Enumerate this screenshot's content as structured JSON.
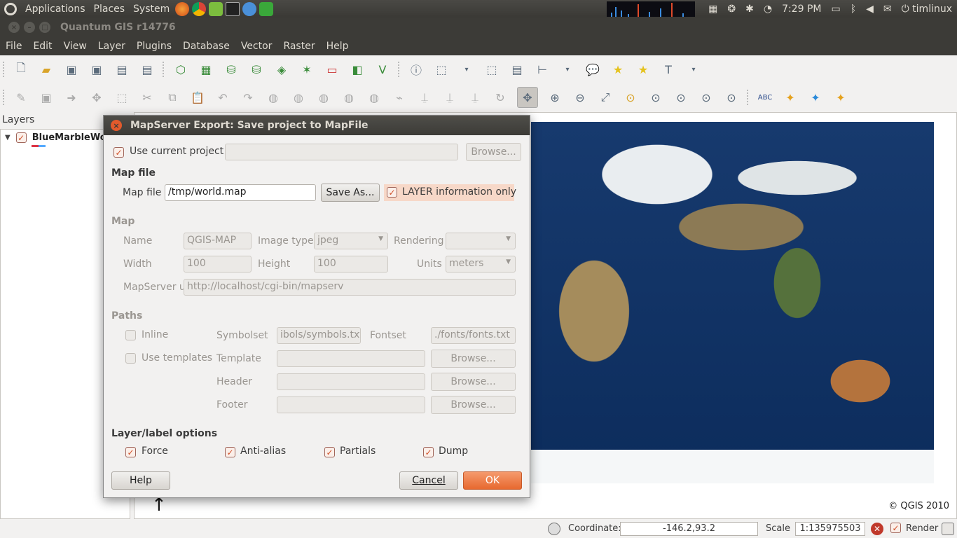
{
  "top_panel": {
    "menus": [
      "Applications",
      "Places",
      "System"
    ],
    "clock": "7:29 PM",
    "user": "timlinux"
  },
  "window": {
    "title": "Quantum GIS r14776"
  },
  "menubar": [
    "File",
    "Edit",
    "View",
    "Layer",
    "Plugins",
    "Database",
    "Vector",
    "Raster",
    "Help"
  ],
  "layers_panel": {
    "title": "Layers",
    "layer_name": "BlueMarbleWorld"
  },
  "map": {
    "copyright": "© QGIS 2010"
  },
  "statusbar": {
    "coordinate_label": "Coordinate:",
    "coordinate_value": "-146.2,93.2",
    "scale_label": "Scale",
    "scale_value": "1:135975503",
    "render_label": "Render"
  },
  "dialog": {
    "title": "MapServer Export: Save project to MapFile",
    "use_current_project": "Use current project",
    "browse": "Browse...",
    "map_file_section": "Map file",
    "map_file_label": "Map file",
    "map_file_value": "/tmp/world.map",
    "save_as": "Save As...",
    "layer_info_only": "LAYER information only",
    "map_section": "Map",
    "name_label": "Name",
    "name_value": "QGIS-MAP",
    "image_type_label": "Image type",
    "image_type_value": "jpeg",
    "rendering_label": "Rendering",
    "rendering_value": "",
    "width_label": "Width",
    "width_value": "100",
    "height_label": "Height",
    "height_value": "100",
    "units_label": "Units",
    "units_value": "meters",
    "mapserver_url_label": "MapServer u",
    "mapserver_url_value": "http://localhost/cgi-bin/mapserv",
    "paths_section": "Paths",
    "inline_label": "Inline",
    "use_templates_label": "Use templates",
    "symbolset_label": "Symbolset",
    "symbolset_value": "ibols/symbols.txt",
    "fontset_label": "Fontset",
    "fontset_value": "./fonts/fonts.txt",
    "template_label": "Template",
    "header_label": "Header",
    "footer_label": "Footer",
    "layer_label_section": "Layer/label options",
    "force_label": "Force",
    "antialias_label": "Anti-alias",
    "partials_label": "Partials",
    "dump_label": "Dump",
    "help_btn": "Help",
    "cancel_btn": "Cancel",
    "ok_btn": "OK"
  }
}
